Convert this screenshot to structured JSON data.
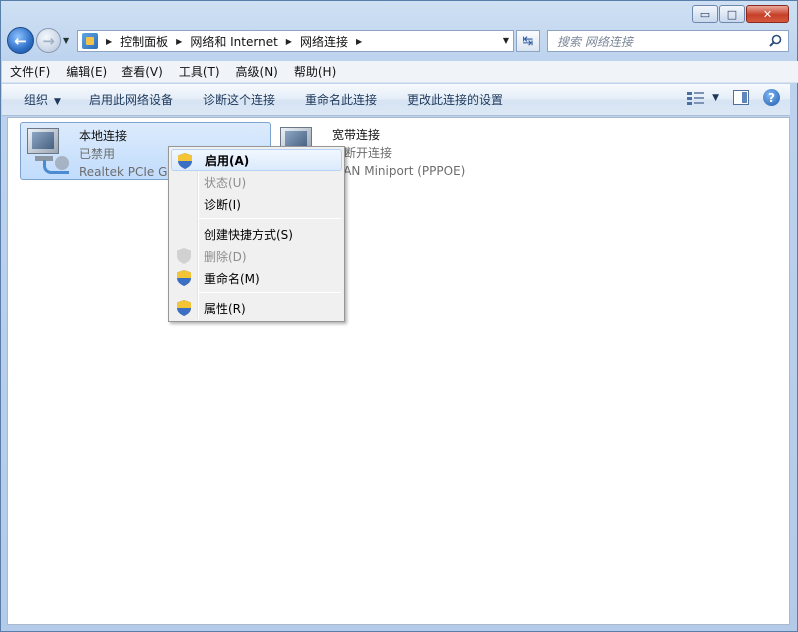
{
  "window": {
    "caption": {
      "minimize": "▭",
      "maximize": "□",
      "close": "✕"
    }
  },
  "nav": {
    "back": "←",
    "forward": "→"
  },
  "address": {
    "crumbs": [
      "控制面板",
      "网络和 Internet",
      "网络连接"
    ]
  },
  "search": {
    "placeholder": "搜索 网络连接"
  },
  "menubar": [
    "文件(F)",
    "编辑(E)",
    "查看(V)",
    "工具(T)",
    "高级(N)",
    "帮助(H)"
  ],
  "commandbar": {
    "organize": "组织",
    "actions": [
      "启用此网络设备",
      "诊断这个连接",
      "重命名此连接",
      "更改此连接的设置"
    ],
    "help": "?"
  },
  "connections": [
    {
      "name": "本地连接",
      "status": "已禁用",
      "device": "Realtek PCIe GE"
    },
    {
      "name": "宽带连接",
      "status": "已断开连接",
      "device": "WAN Miniport (PPPOE)"
    }
  ],
  "context_menu": [
    {
      "label": "启用(A)",
      "icon": "uac-shield-icon",
      "state": "highlighted-default"
    },
    {
      "label": "状态(U)",
      "icon": "",
      "state": "disabled"
    },
    {
      "label": "诊断(I)",
      "icon": "",
      "state": "normal"
    },
    {
      "label": "创建快捷方式(S)",
      "icon": "",
      "state": "normal"
    },
    {
      "label": "删除(D)",
      "icon": "uac-shield-icon",
      "state": "disabled"
    },
    {
      "label": "重命名(M)",
      "icon": "uac-shield-icon",
      "state": "normal"
    },
    {
      "label": "属性(R)",
      "icon": "uac-shield-icon",
      "state": "normal"
    }
  ],
  "colors": {
    "window_frame": "#b3cbe9",
    "selection": "#c1dcfc",
    "close_button": "#c7402a"
  }
}
